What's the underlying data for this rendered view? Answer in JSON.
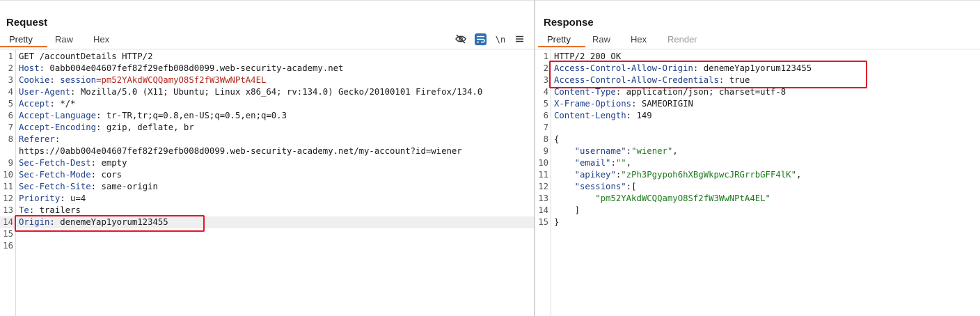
{
  "request": {
    "title": "Request",
    "tabs": [
      "Pretty",
      "Raw",
      "Hex"
    ],
    "toolbar": {
      "hide_icon": "eye-slash-icon",
      "wrap_icon": "wrap-lines-icon",
      "newline_label": "\\n",
      "menu_icon": "hamburger-menu-icon"
    },
    "lines": [
      {
        "n": "1",
        "parts": [
          {
            "t": "GET /accountDetails HTTP/2",
            "c": "plain"
          }
        ]
      },
      {
        "n": "2",
        "parts": [
          {
            "t": "Host",
            "c": "hname"
          },
          {
            "t": ": 0abb004e04607fef82f29efb008d0099.web-security-academy.net",
            "c": "plain"
          }
        ]
      },
      {
        "n": "3",
        "parts": [
          {
            "t": "Cookie",
            "c": "hname"
          },
          {
            "t": ": ",
            "c": "plain"
          },
          {
            "t": "session",
            "c": "hname"
          },
          {
            "t": "=",
            "c": "plain"
          },
          {
            "t": "pm52YAkdWCQQamyO8Sf2fW3WwNPtA4EL",
            "c": "cval"
          }
        ]
      },
      {
        "n": "4",
        "parts": [
          {
            "t": "User-Agent",
            "c": "hname"
          },
          {
            "t": ": Mozilla/5.0 (X11; Ubuntu; Linux x86_64; rv:134.0) Gecko/20100101 Firefox/134.0",
            "c": "plain"
          }
        ]
      },
      {
        "n": "5",
        "parts": [
          {
            "t": "Accept",
            "c": "hname"
          },
          {
            "t": ": */*",
            "c": "plain"
          }
        ]
      },
      {
        "n": "6",
        "parts": [
          {
            "t": "Accept-Language",
            "c": "hname"
          },
          {
            "t": ": tr-TR,tr;q=0.8,en-US;q=0.5,en;q=0.3",
            "c": "plain"
          }
        ]
      },
      {
        "n": "7",
        "parts": [
          {
            "t": "Accept-Encoding",
            "c": "hname"
          },
          {
            "t": ": gzip, deflate, br",
            "c": "plain"
          }
        ]
      },
      {
        "n": "8",
        "parts": [
          {
            "t": "Referer",
            "c": "hname"
          },
          {
            "t": ":",
            "c": "plain"
          }
        ]
      },
      {
        "n": "",
        "parts": [
          {
            "t": "https://0abb004e04607fef82f29efb008d0099.web-security-academy.net/my-account?id=wiener",
            "c": "plain"
          }
        ]
      },
      {
        "n": "9",
        "parts": [
          {
            "t": "Sec-Fetch-Dest",
            "c": "hname"
          },
          {
            "t": ": empty",
            "c": "plain"
          }
        ]
      },
      {
        "n": "10",
        "parts": [
          {
            "t": "Sec-Fetch-Mode",
            "c": "hname"
          },
          {
            "t": ": cors",
            "c": "plain"
          }
        ]
      },
      {
        "n": "11",
        "parts": [
          {
            "t": "Sec-Fetch-Site",
            "c": "hname"
          },
          {
            "t": ": same-origin",
            "c": "plain"
          }
        ]
      },
      {
        "n": "12",
        "parts": [
          {
            "t": "Priority",
            "c": "hname"
          },
          {
            "t": ": u=4",
            "c": "plain"
          }
        ]
      },
      {
        "n": "13",
        "parts": [
          {
            "t": "Te",
            "c": "hname"
          },
          {
            "t": ": trailers",
            "c": "plain"
          }
        ]
      },
      {
        "n": "14",
        "parts": [
          {
            "t": "Origin",
            "c": "hname"
          },
          {
            "t": ": denemeYap1yorum123455",
            "c": "plain"
          }
        ],
        "highlight": true
      },
      {
        "n": "15",
        "parts": []
      },
      {
        "n": "16",
        "parts": []
      }
    ]
  },
  "response": {
    "title": "Response",
    "tabs": [
      "Pretty",
      "Raw",
      "Hex",
      "Render"
    ],
    "lines": [
      {
        "n": "1",
        "parts": [
          {
            "t": "HTTP/2 200 OK",
            "c": "plain"
          }
        ]
      },
      {
        "n": "2",
        "parts": [
          {
            "t": "Access-Control-Allow-Origin",
            "c": "hname"
          },
          {
            "t": ": denemeYap1yorum123455",
            "c": "plain"
          }
        ]
      },
      {
        "n": "3",
        "parts": [
          {
            "t": "Access-Control-Allow-Credentials",
            "c": "hname"
          },
          {
            "t": ": true",
            "c": "plain"
          }
        ]
      },
      {
        "n": "4",
        "parts": [
          {
            "t": "Content-Type",
            "c": "hname"
          },
          {
            "t": ": application/json; charset=utf-8",
            "c": "plain"
          }
        ]
      },
      {
        "n": "5",
        "parts": [
          {
            "t": "X-Frame-Options",
            "c": "hname"
          },
          {
            "t": ": SAMEORIGIN",
            "c": "plain"
          }
        ]
      },
      {
        "n": "6",
        "parts": [
          {
            "t": "Content-Length",
            "c": "hname"
          },
          {
            "t": ": 149",
            "c": "plain"
          }
        ]
      },
      {
        "n": "7",
        "parts": []
      },
      {
        "n": "8",
        "parts": [
          {
            "t": "{",
            "c": "plain"
          }
        ]
      },
      {
        "n": "9",
        "parts": [
          {
            "t": "    ",
            "c": "plain"
          },
          {
            "t": "\"username\"",
            "c": "jkey"
          },
          {
            "t": ":",
            "c": "plain"
          },
          {
            "t": "\"wiener\"",
            "c": "jstr"
          },
          {
            "t": ",",
            "c": "plain"
          }
        ]
      },
      {
        "n": "10",
        "parts": [
          {
            "t": "    ",
            "c": "plain"
          },
          {
            "t": "\"email\"",
            "c": "jkey"
          },
          {
            "t": ":",
            "c": "plain"
          },
          {
            "t": "\"\"",
            "c": "jstr"
          },
          {
            "t": ",",
            "c": "plain"
          }
        ]
      },
      {
        "n": "11",
        "parts": [
          {
            "t": "    ",
            "c": "plain"
          },
          {
            "t": "\"apikey\"",
            "c": "jkey"
          },
          {
            "t": ":",
            "c": "plain"
          },
          {
            "t": "\"zPh3Pgypoh6hXBgWkpwcJRGrrbGFF4lK\"",
            "c": "jstr"
          },
          {
            "t": ",",
            "c": "plain"
          }
        ]
      },
      {
        "n": "12",
        "parts": [
          {
            "t": "    ",
            "c": "plain"
          },
          {
            "t": "\"sessions\"",
            "c": "jkey"
          },
          {
            "t": ":[",
            "c": "plain"
          }
        ]
      },
      {
        "n": "13",
        "parts": [
          {
            "t": "        ",
            "c": "plain"
          },
          {
            "t": "\"pm52YAkdWCQQamyO8Sf2fW3WwNPtA4EL\"",
            "c": "jstr"
          }
        ]
      },
      {
        "n": "14",
        "parts": [
          {
            "t": "    ]",
            "c": "plain"
          }
        ]
      },
      {
        "n": "15",
        "parts": [
          {
            "t": "}",
            "c": "plain"
          }
        ]
      }
    ]
  },
  "colors": {
    "accent": "#e8702a",
    "highlight_box": "#e0182a",
    "header_name": "#1d3f8a",
    "cookie_value": "#b3261e",
    "json_string": "#1b7a1b"
  }
}
